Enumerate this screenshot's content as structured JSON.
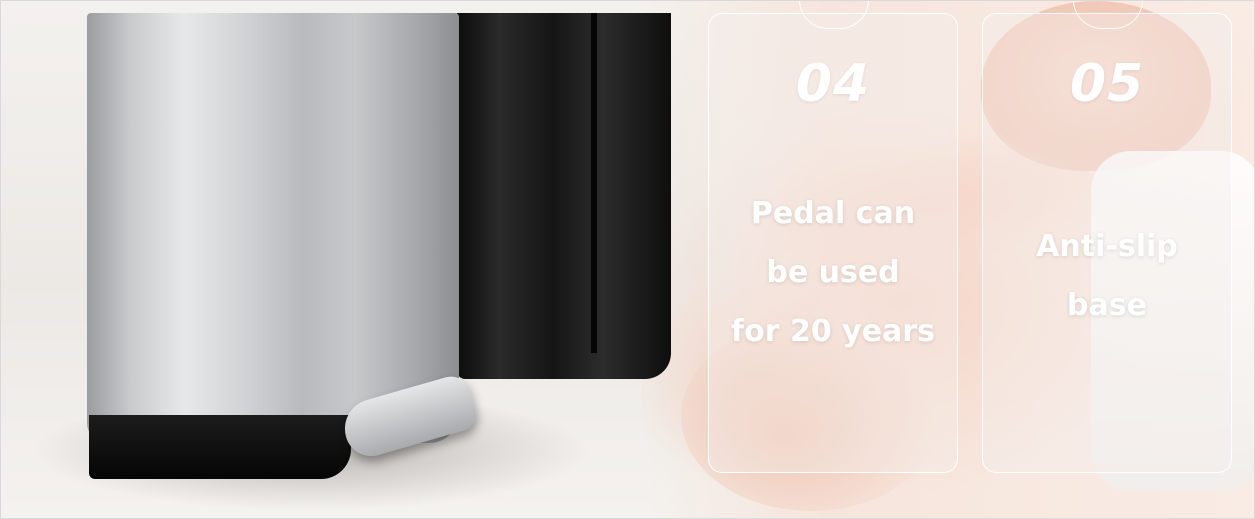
{
  "cards": [
    {
      "number": "04",
      "lines": [
        "Pedal can",
        "be used",
        "for 20 years"
      ]
    },
    {
      "number": "05",
      "lines": [
        "Anti-slip",
        "base"
      ]
    }
  ],
  "colors": {
    "card_text": "#ffffff",
    "card_border": "#ffffff",
    "bin_silver": "#c9cbcd",
    "bin_black": "#151515",
    "background_skin": "#f6d7ca"
  }
}
